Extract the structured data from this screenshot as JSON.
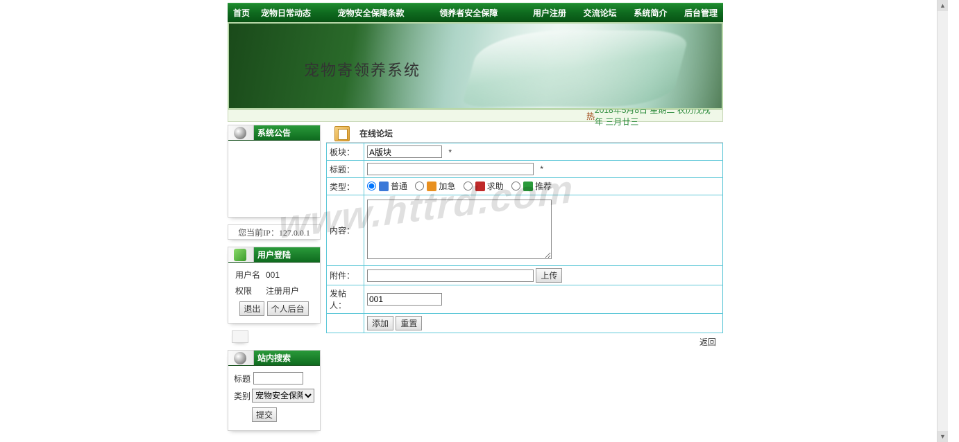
{
  "nav": {
    "items": [
      "首页",
      "宠物日常动态",
      "宠物安全保障条款",
      "领养者安全保障",
      "用户注册",
      "交流论坛",
      "系统简介",
      "后台管理"
    ]
  },
  "banner": {
    "title": "宠物寄领养系统"
  },
  "status": {
    "hot_label": "热",
    "date_text": "2018年5月8日  星期二  农历戊戌年  三月廿三"
  },
  "left": {
    "announce": {
      "title": "系统公告"
    },
    "ip_text": "您当前IP：127.0.0.1",
    "login": {
      "title": "用户登陆",
      "username_label": "用户名",
      "username_value": "001",
      "role_label": "权限",
      "role_value": "注册用户",
      "logout_btn": "退出",
      "admin_btn": "个人后台"
    },
    "search": {
      "title": "站内搜索",
      "label_title": "标题",
      "label_category": "类别",
      "category_value": "宠物安全保障条款",
      "submit": "提交"
    }
  },
  "forum": {
    "section_title": "在线论坛",
    "labels": {
      "board": "板块：",
      "title": "标题：",
      "type": "类型：",
      "content": "内容：",
      "attachment": "附件：",
      "poster": "发帖人："
    },
    "board_value": "A版块",
    "title_value": "",
    "required_mark": "*",
    "types": [
      {
        "label": "普通",
        "icon": "ti-blue",
        "checked": true
      },
      {
        "label": "加急",
        "icon": "ti-orange",
        "checked": false
      },
      {
        "label": "求助",
        "icon": "ti-red",
        "checked": false
      },
      {
        "label": "推荐",
        "icon": "ti-green",
        "checked": false
      }
    ],
    "content_value": "",
    "attachment_value": "",
    "upload_btn": "上传",
    "poster_value": "001",
    "submit_btn": "添加",
    "reset_btn": "重置",
    "return_link": "返回"
  },
  "watermark": "www.httrd.com"
}
